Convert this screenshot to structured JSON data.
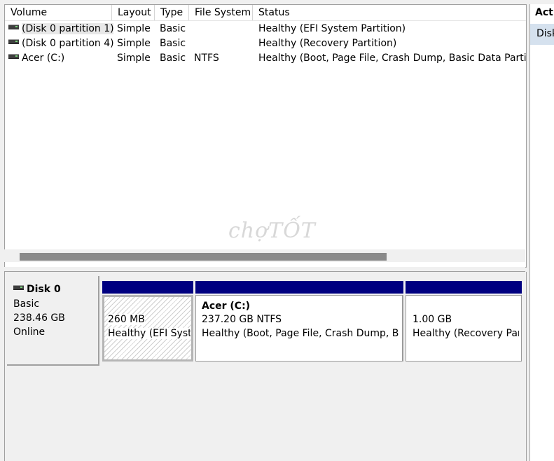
{
  "volume_list": {
    "columns": [
      "Volume",
      "Layout",
      "Type",
      "File System",
      "Status"
    ],
    "rows": [
      {
        "volume": "(Disk 0 partition 1)",
        "layout": "Simple",
        "type": "Basic",
        "fs": "",
        "status": "Healthy (EFI System Partition)"
      },
      {
        "volume": "(Disk 0 partition 4)",
        "layout": "Simple",
        "type": "Basic",
        "fs": "",
        "status": "Healthy (Recovery Partition)"
      },
      {
        "volume": "Acer (C:)",
        "layout": "Simple",
        "type": "Basic",
        "fs": "NTFS",
        "status": "Healthy (Boot, Page File, Crash Dump, Basic Data Partition)"
      }
    ]
  },
  "disk": {
    "name": "Disk 0",
    "type": "Basic",
    "size": "238.46 GB",
    "state": "Online",
    "partitions": [
      {
        "title": "",
        "size": "260 MB",
        "status": "Healthy (EFI System Partition)"
      },
      {
        "title": "Acer  (C:)",
        "size": "237.20 GB NTFS",
        "status": "Healthy (Boot, Page File, Crash Dump, Basic Data Partition)"
      },
      {
        "title": "",
        "size": "1.00 GB",
        "status": "Healthy (Recovery Partition)"
      }
    ]
  },
  "watermark": "chợTỐT",
  "actions": {
    "title": "Actions",
    "item": "Disk Management"
  },
  "colors": {
    "partition_bar": "#000080",
    "selection": "#d5e1ee"
  }
}
